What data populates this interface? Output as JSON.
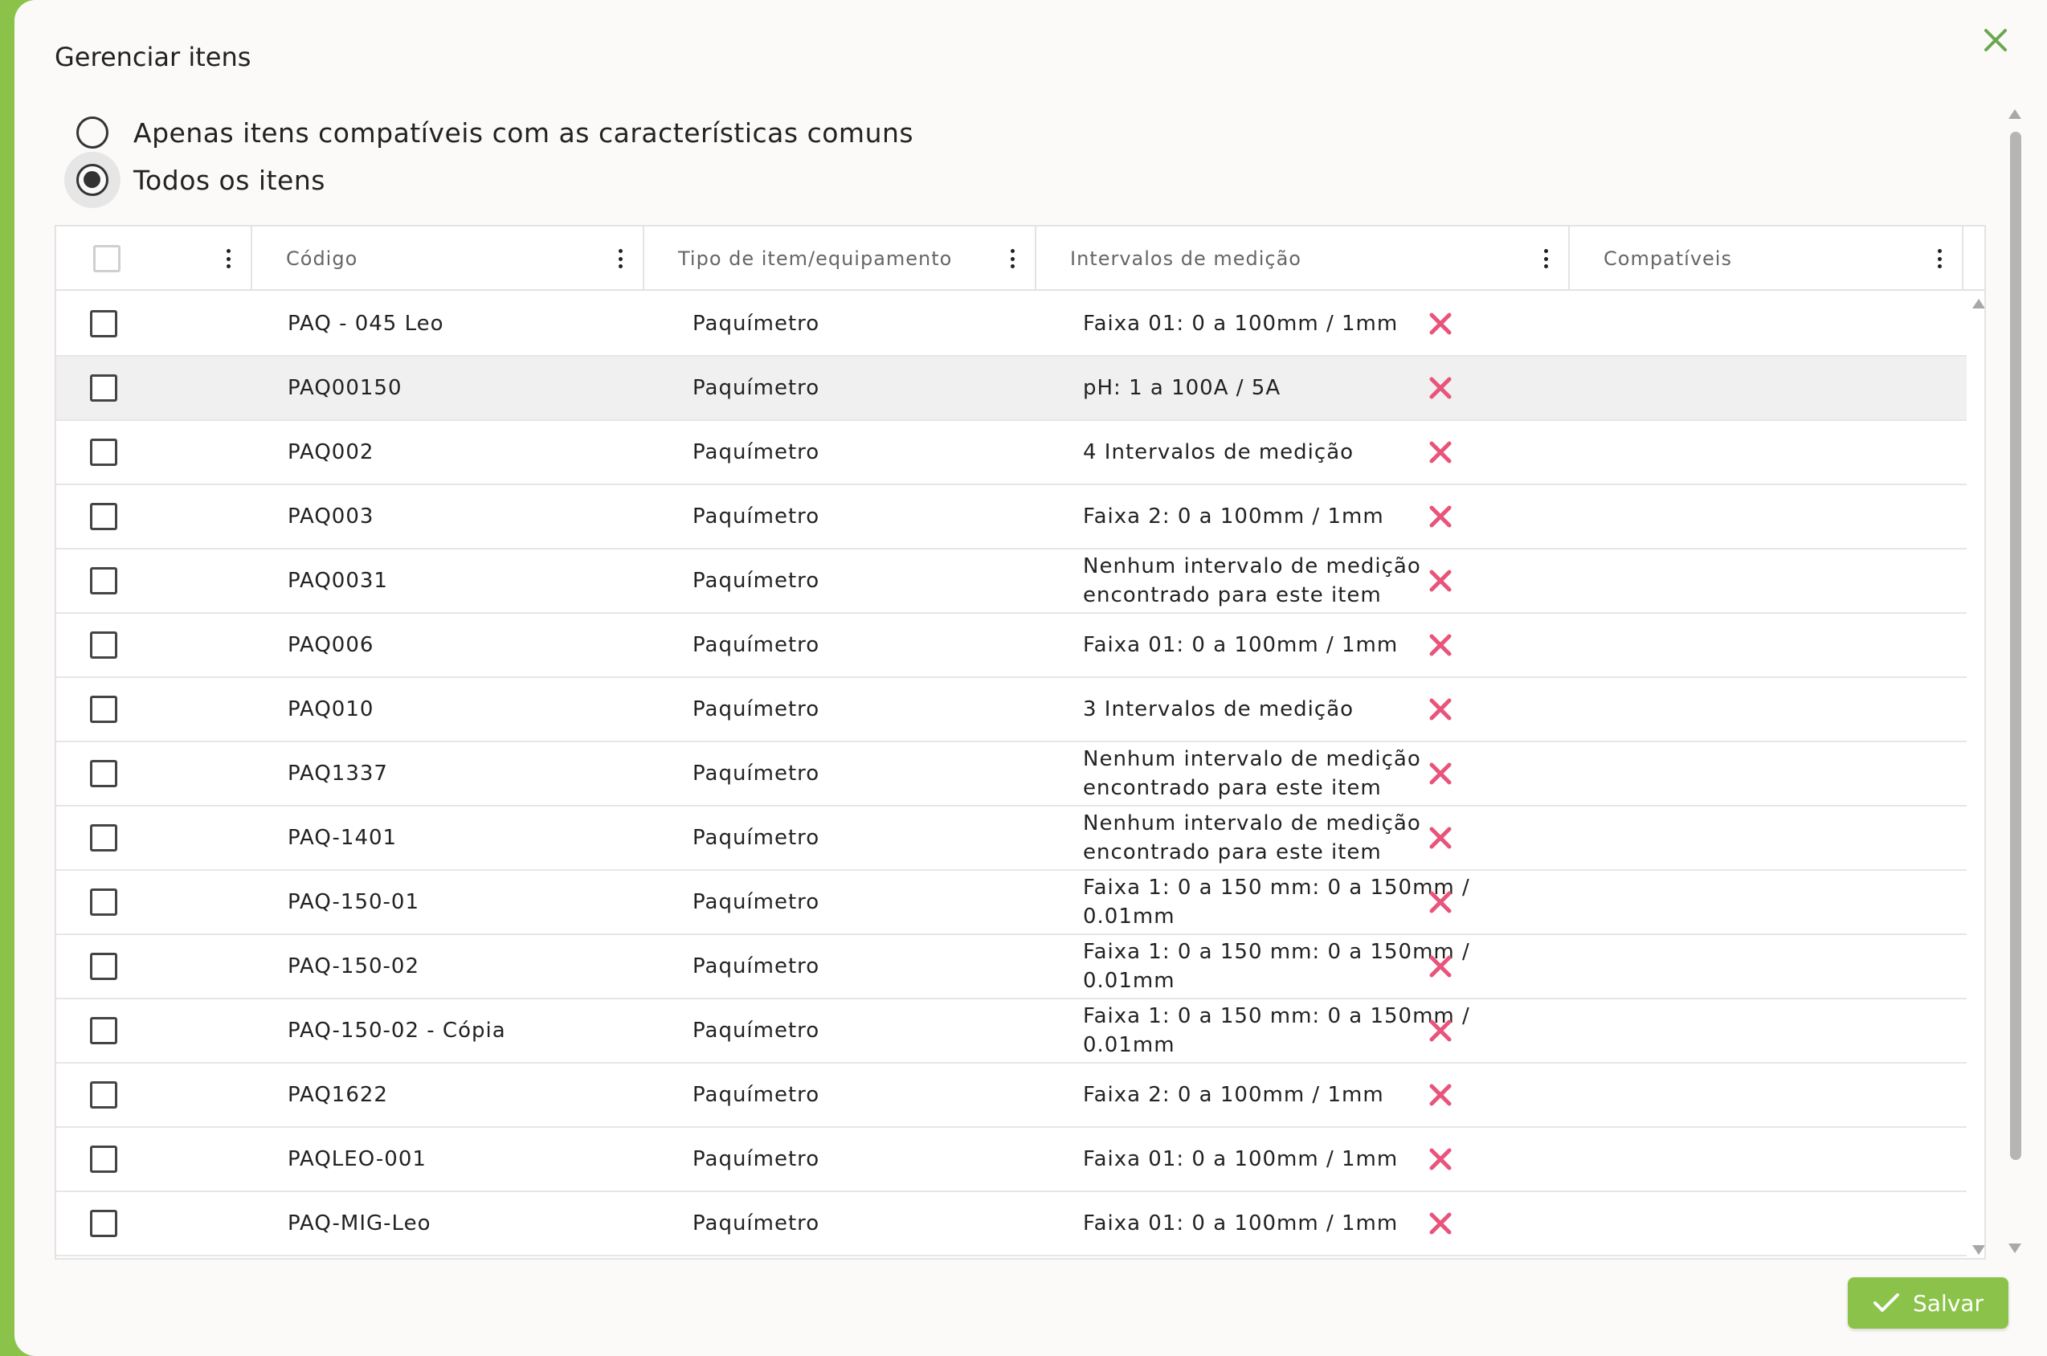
{
  "dialog": {
    "title": "Gerenciar itens"
  },
  "filter": {
    "options": [
      {
        "label": "Apenas itens compatíveis com as características comuns",
        "selected": false
      },
      {
        "label": "Todos os itens",
        "selected": true
      }
    ]
  },
  "table": {
    "columns": [
      {
        "label": ""
      },
      {
        "label": "Código"
      },
      {
        "label": "Tipo de item/equipamento"
      },
      {
        "label": "Intervalos de medição"
      },
      {
        "label": "Compatíveis"
      }
    ],
    "rows": [
      {
        "code": "PAQ - 045 Leo",
        "type": "Paquímetro",
        "range": "Faixa 01: 0 a 100mm / 1mm",
        "compatible": false
      },
      {
        "code": "PAQ00150",
        "type": "Paquímetro",
        "range": "pH: 1 a 100A / 5A",
        "compatible": false
      },
      {
        "code": "PAQ002",
        "type": "Paquímetro",
        "range": "4 Intervalos de medição",
        "compatible": false
      },
      {
        "code": "PAQ003",
        "type": "Paquímetro",
        "range": "Faixa 2: 0 a 100mm / 1mm",
        "compatible": false
      },
      {
        "code": "PAQ0031",
        "type": "Paquímetro",
        "range": "Nenhum intervalo de medição encontrado para este item",
        "compatible": false
      },
      {
        "code": "PAQ006",
        "type": "Paquímetro",
        "range": "Faixa 01: 0 a 100mm / 1mm",
        "compatible": false
      },
      {
        "code": "PAQ010",
        "type": "Paquímetro",
        "range": "3 Intervalos de medição",
        "compatible": false
      },
      {
        "code": "PAQ1337",
        "type": "Paquímetro",
        "range": "Nenhum intervalo de medição encontrado para este item",
        "compatible": false
      },
      {
        "code": "PAQ-1401",
        "type": "Paquímetro",
        "range": "Nenhum intervalo de medição encontrado para este item",
        "compatible": false
      },
      {
        "code": "PAQ-150-01",
        "type": "Paquímetro",
        "range": "Faixa 1: 0 a 150 mm: 0 a 150mm / 0.01mm",
        "compatible": false
      },
      {
        "code": "PAQ-150-02",
        "type": "Paquímetro",
        "range": "Faixa 1: 0 a 150 mm: 0 a 150mm / 0.01mm",
        "compatible": false
      },
      {
        "code": "PAQ-150-02 - Cópia",
        "type": "Paquímetro",
        "range": "Faixa 1: 0 a 150 mm: 0 a 150mm / 0.01mm",
        "compatible": false
      },
      {
        "code": "PAQ1622",
        "type": "Paquímetro",
        "range": "Faixa 2: 0 a 100mm / 1mm",
        "compatible": false
      },
      {
        "code": "PAQLEO-001",
        "type": "Paquímetro",
        "range": "Faixa 01: 0 a 100mm / 1mm",
        "compatible": false
      },
      {
        "code": "PAQ-MIG-Leo",
        "type": "Paquímetro",
        "range": "Faixa 01: 0 a 100mm / 1mm",
        "compatible": false
      }
    ]
  },
  "footer": {
    "save_label": "Salvar"
  },
  "icons": {
    "close": "close-icon",
    "incompatible": "x-icon",
    "save": "check-icon",
    "column_menu": "kebab-menu-icon"
  },
  "colors": {
    "accent": "#8bc34a",
    "incompatible": "#e8547a",
    "hover_row": "#f0f0f0"
  }
}
